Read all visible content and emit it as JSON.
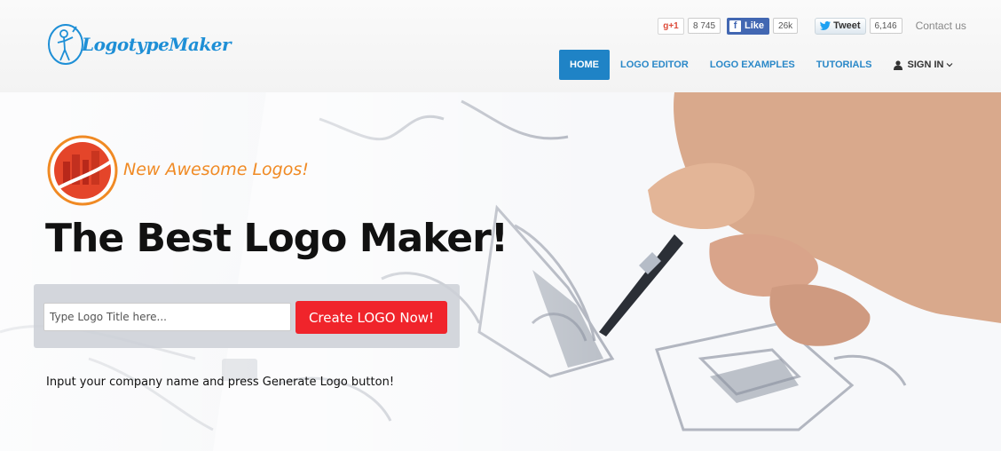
{
  "header": {
    "logo_text": "LogotypeMaker",
    "social": {
      "gplus_label": "+1",
      "gplus_count": "8 745",
      "fb_label": "Like",
      "fb_count": "26k",
      "tweet_label": "Tweet",
      "tweet_count": "6,146"
    },
    "contact_label": "Contact us",
    "nav": [
      {
        "label": "HOME",
        "active": true
      },
      {
        "label": "LOGO EDITOR",
        "active": false
      },
      {
        "label": "LOGO EXAMPLES",
        "active": false
      },
      {
        "label": "TUTORIALS",
        "active": false
      },
      {
        "label": "SIGN IN",
        "active": false
      }
    ]
  },
  "hero": {
    "tagline": "New Awesome Logos!",
    "title": "The Best Logo Maker!",
    "input_placeholder": "Type Logo Title here...",
    "button_label": "Create LOGO Now!",
    "hint": "Input your company name and press Generate Logo button!"
  },
  "colors": {
    "brand_blue": "#1f83c6",
    "cta_red": "#f0242b",
    "tagline_orange": "#f08a24"
  },
  "icons": [
    "logo-figure-icon",
    "gplus-icon",
    "facebook-icon",
    "twitter-bird-icon",
    "user-icon",
    "chevron-down-icon",
    "city-badge-icon"
  ]
}
